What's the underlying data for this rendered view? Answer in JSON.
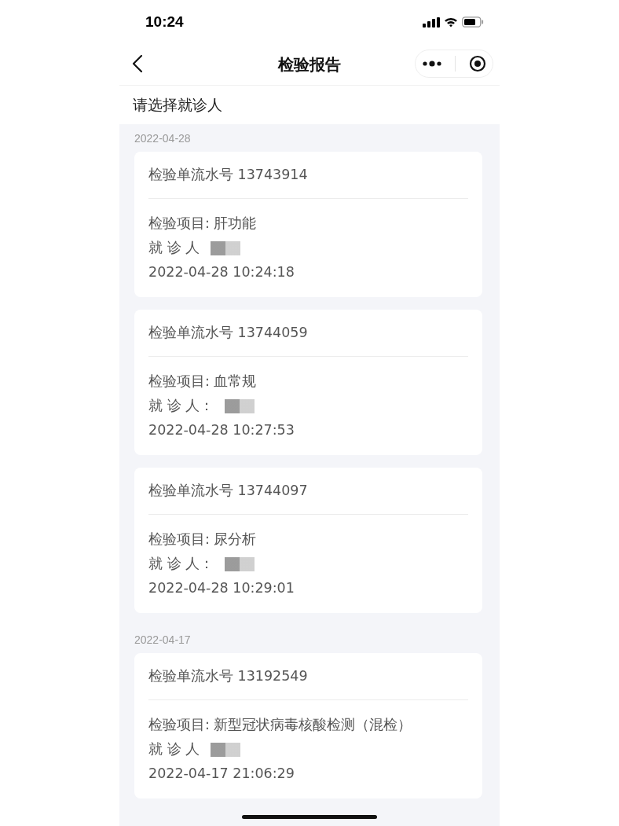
{
  "status_bar": {
    "time": "10:24"
  },
  "nav": {
    "title": "检验报告"
  },
  "patient_select": {
    "label": "请选择就诊人"
  },
  "groups": [
    {
      "date": "2022-04-28",
      "reports": [
        {
          "serial": "检验单流水号 13743914",
          "item": "检验项目: 肝功能",
          "patient_label": "就 诊 人",
          "time": "2022-04-28 10:24:18"
        },
        {
          "serial": "检验单流水号 13744059",
          "item": "检验项目: 血常规",
          "patient_label": "就 诊 人：",
          "time": "2022-04-28 10:27:53"
        },
        {
          "serial": "检验单流水号 13744097",
          "item": "检验项目: 尿分析",
          "patient_label": "就 诊 人：",
          "time": "2022-04-28 10:29:01"
        }
      ]
    },
    {
      "date": "2022-04-17",
      "reports": [
        {
          "serial": "检验单流水号 13192549",
          "item": "检验项目: 新型冠状病毒核酸检测（混检）",
          "patient_label": "就 诊 人",
          "time": "2022-04-17 21:06:29"
        }
      ]
    }
  ]
}
